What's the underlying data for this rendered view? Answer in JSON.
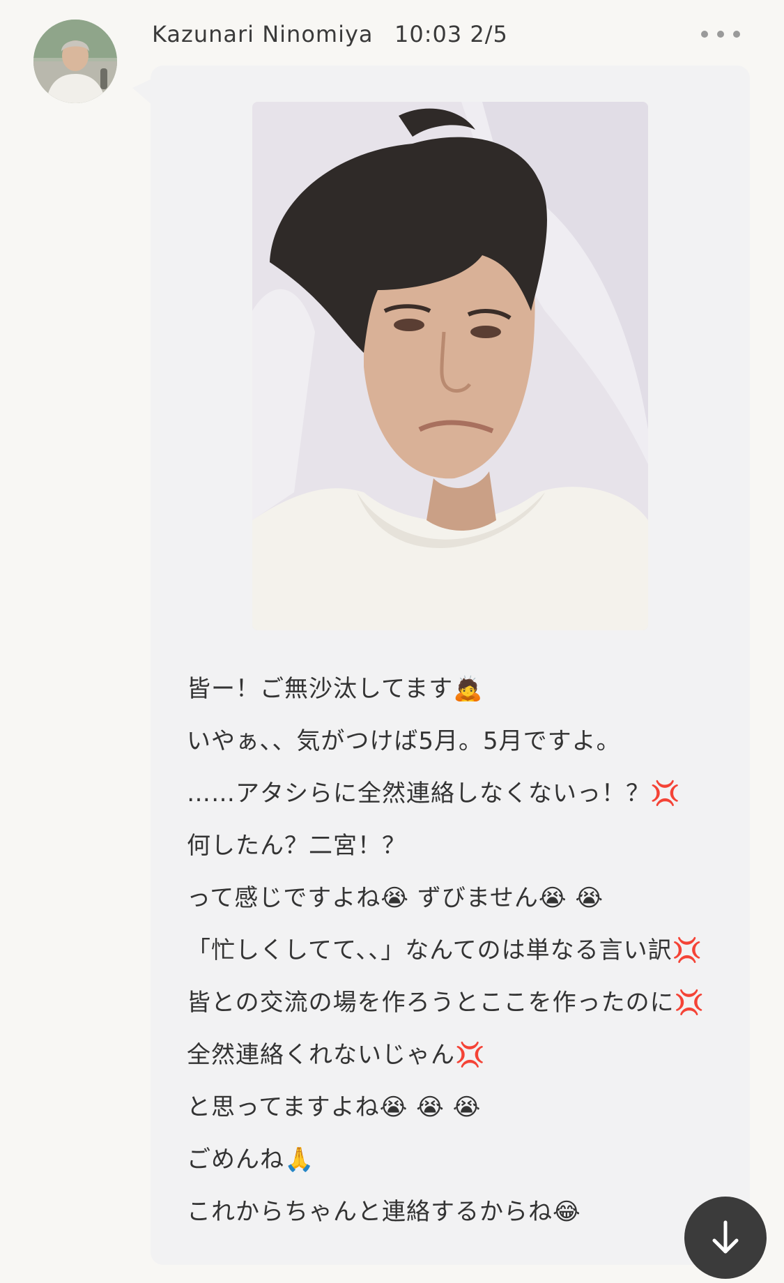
{
  "header": {
    "author_name": "Kazunari Ninomiya",
    "timestamp": "10:03 2/5",
    "more_icon": "more-horizontal-icon",
    "avatar_alt": "Kazunari Ninomiya avatar"
  },
  "post": {
    "photo_alt": "Selfie lying on a white pillow",
    "message_lines": [
      "皆ー！ご無沙汰してます🙇",
      "いやぁ、、気がつけば5月。5月ですよ。",
      "……アタシらに全然連絡しなくないっ！？💢",
      "何したん？二宮！？",
      "って感じですよね😭 ずびません😭 😭",
      "「忙しくしてて、、」なんてのは単なる言い訳💢",
      "皆との交流の場を作ろうとここを作ったのに💢",
      "全然連絡くれないじゃん💢",
      "と思ってますよね😭 😭 😭",
      "ごめんね🙏",
      "これからちゃんと連絡するからね😂"
    ]
  },
  "controls": {
    "scroll_down_icon": "arrow-down-icon",
    "scroll_down_label": "Scroll to latest"
  },
  "colors": {
    "background": "#f8f7f4",
    "bubble": "#f2f2f3",
    "fab": "#3b3b3b"
  }
}
